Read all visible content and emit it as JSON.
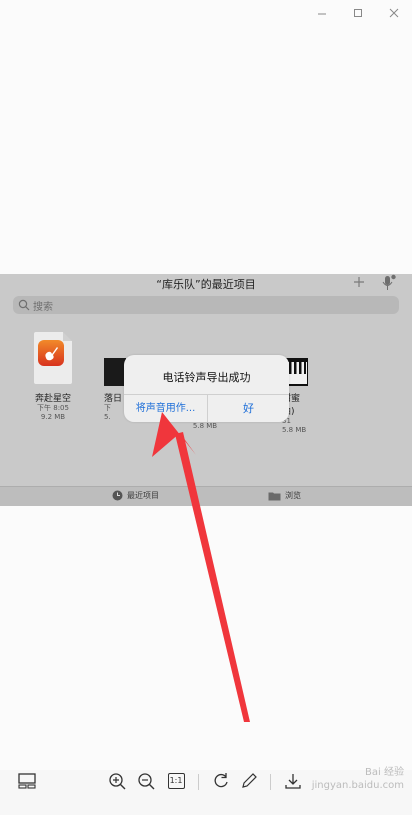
{
  "shot": {
    "title": "“库乐队”的最近项目",
    "search_placeholder": "搜索",
    "files": [
      {
        "name": "奔赴星空",
        "time": "下午 8:05",
        "size": "9.2 MB"
      },
      {
        "name": "落日",
        "time": "下",
        "size": "5."
      },
      {
        "name": "",
        "time": "",
        "size": "5.8 MB"
      },
      {
        "name": "甜蜜",
        "name2": "曲)",
        "time": "31",
        "size": "5.8 MB"
      }
    ],
    "tabs": [
      {
        "label": "最近项目"
      },
      {
        "label": "浏览"
      }
    ],
    "alert": {
      "title": "电话铃声导出成功",
      "left_button": "将声音用作...",
      "right_button": "好"
    }
  },
  "toolbar": {
    "fit_label": "1:1",
    "watermark_line1": "Bai 经验",
    "watermark_line2": "jingyan.baidu.com"
  },
  "colors": {
    "alert_button": "#1d6ed8",
    "arrow": "#f0363c"
  }
}
